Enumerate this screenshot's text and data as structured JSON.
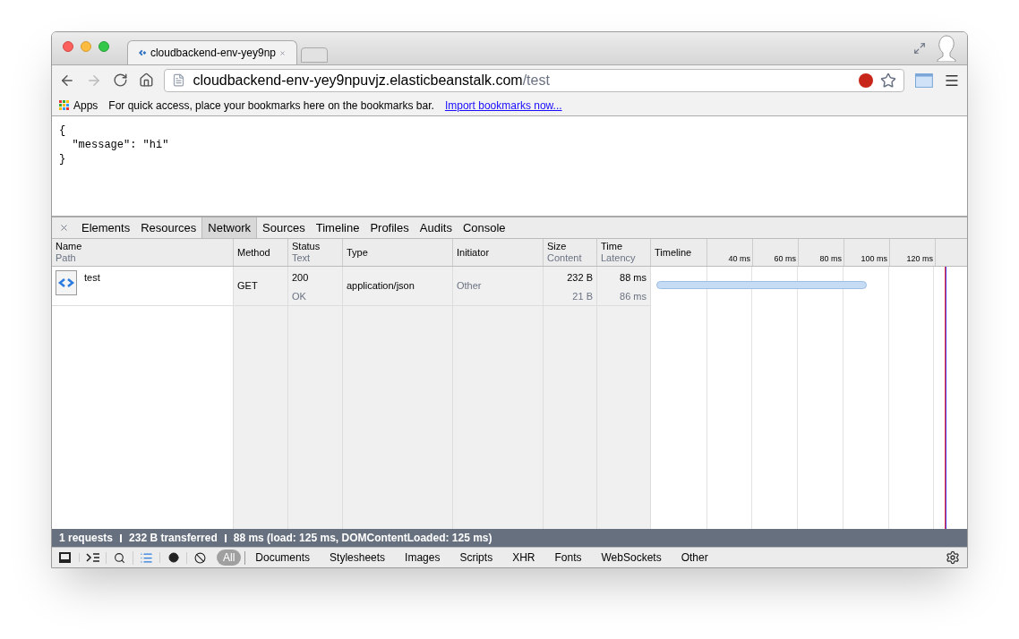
{
  "browser_tabs": [
    {
      "title": "cloudbackend-env-yey9np",
      "selected": true
    }
  ],
  "address": {
    "host": "cloudbackend-env-yey9npuvjz.elasticbeanstalk.com",
    "path": "/test"
  },
  "bookmarks": {
    "apps": "Apps",
    "hint": "For quick access, place your bookmarks here on the bookmarks bar.",
    "link": "Import bookmarks now..."
  },
  "page_lines": [
    "{",
    "  \"message\": \"hi\"",
    "}"
  ],
  "devtools_tabs": [
    {
      "label": "Elements",
      "selected": false
    },
    {
      "label": "Resources",
      "selected": false
    },
    {
      "label": "Network",
      "selected": true
    },
    {
      "label": "Sources",
      "selected": false
    },
    {
      "label": "Timeline",
      "selected": false
    },
    {
      "label": "Profiles",
      "selected": false
    },
    {
      "label": "Audits",
      "selected": false
    },
    {
      "label": "Console",
      "selected": false
    }
  ],
  "columns": [
    {
      "title": "Name",
      "subtitle": "Path"
    },
    {
      "title": "Method"
    },
    {
      "title": "Status",
      "subtitle": "Text"
    },
    {
      "title": "Type"
    },
    {
      "title": "Initiator"
    },
    {
      "title": "Size",
      "subtitle": "Content"
    },
    {
      "title": "Time",
      "subtitle": "Latency"
    },
    {
      "title": "Timeline"
    }
  ],
  "timeline_ticks": [
    "40 ms",
    "60 ms",
    "80 ms",
    "100 ms",
    "120 ms"
  ],
  "rows": [
    {
      "name": "test",
      "method": "GET",
      "status": "200",
      "status_text": "OK",
      "type": "application/json",
      "initiator": "Other",
      "size": "232 B",
      "content": "21 B",
      "time": "88 ms",
      "latency": "86 ms"
    }
  ],
  "summary": [
    {
      "text": "1 requests"
    },
    {
      "text": "232 B transferred"
    },
    {
      "text": "88 ms (load: 125 ms, DOMContentLoaded: 125 ms)"
    }
  ],
  "filters": [
    {
      "label": "All",
      "selected": true
    },
    {
      "label": "Documents",
      "selected": false
    },
    {
      "label": "Stylesheets",
      "selected": false
    },
    {
      "label": "Images",
      "selected": false
    },
    {
      "label": "Scripts",
      "selected": false
    },
    {
      "label": "XHR",
      "selected": false
    },
    {
      "label": "Fonts",
      "selected": false
    },
    {
      "label": "WebSockets",
      "selected": false
    },
    {
      "label": "Other",
      "selected": false
    }
  ]
}
